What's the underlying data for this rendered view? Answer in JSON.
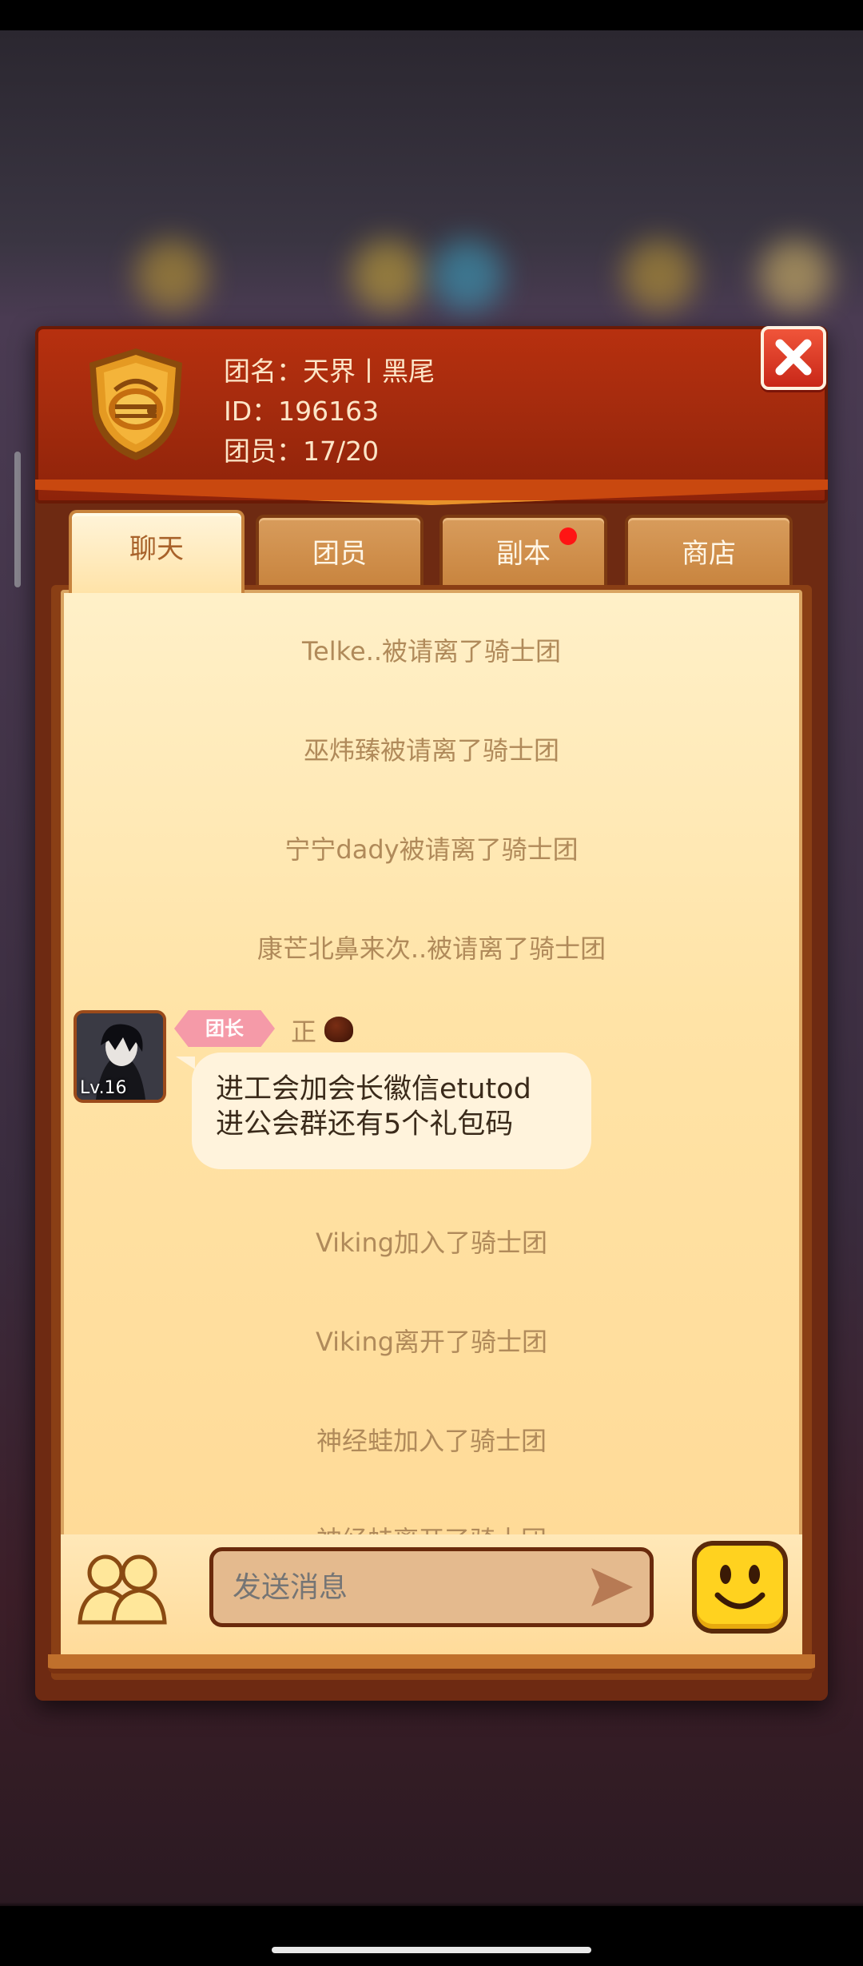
{
  "guild": {
    "name": "团名：天界丨黑尾",
    "id": "ID：196163",
    "members": "团员：17/20"
  },
  "tabs": [
    {
      "label": "聊天",
      "active": true
    },
    {
      "label": "团员",
      "active": false
    },
    {
      "label": "副本",
      "active": false,
      "badge": "red-dot"
    },
    {
      "label": "商店",
      "active": false
    }
  ],
  "chat": {
    "system_messages_top": [
      "Telke..被请离了骑士团",
      "巫炜臻被请离了骑士团",
      "宁宁dady被请离了骑士团",
      "康芒北鼻来次..被请离了骑士团"
    ],
    "message": {
      "role": "团长",
      "sender": "正",
      "avatar_level": "Lv.16",
      "lines": [
        "进工会加会长徽信etutod",
        "进公会群还有5个礼包码"
      ]
    },
    "system_messages_bottom": [
      "Viking加入了骑士团",
      "Viking离开了骑士团",
      "神经蛙加入了骑士团",
      "神经蛙离开了骑士团"
    ]
  },
  "input": {
    "placeholder": "发送消息"
  },
  "icons": {
    "close": "close-icon",
    "guild_emblem": "knight-helmet-shield-icon",
    "members": "people-icon",
    "send": "send-arrow-icon",
    "emoji": "smiley-icon"
  },
  "colors": {
    "header": "#a12a0d",
    "chat_bg": "#ffe3a6",
    "badge": "#f59aa8",
    "red_dot": "#ff1414",
    "emoji_button": "#ffd21f"
  }
}
